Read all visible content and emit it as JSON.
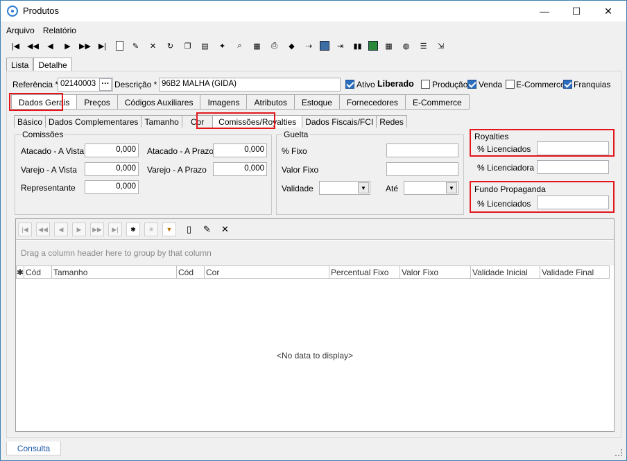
{
  "window": {
    "title": "Produtos",
    "min": "—",
    "max": "☐",
    "close": "✕"
  },
  "menu": {
    "file": "Arquivo",
    "report": "Relatório"
  },
  "main_tabs": [
    "Lista",
    "Detalhe"
  ],
  "header": {
    "ref_label": "Referência *",
    "ref_value": "02140003",
    "ref_btn": "···",
    "desc_label": "Descrição *",
    "desc_value": "96B2 MALHA (GIDA)",
    "ativo_label": "Ativo",
    "status_text": "Liberado",
    "producao_label": "Produção",
    "venda_label": "Venda",
    "ecommerce_label": "E-Commerce",
    "franquias_label": "Franquias"
  },
  "section_tabs": [
    "Dados Gerais",
    "Preços",
    "Códigos Auxiliares",
    "Imagens",
    "Atributos",
    "Estoque",
    "Fornecedores",
    "E-Commerce"
  ],
  "sub_tabs": [
    "Básico",
    "Dados Complementares",
    "Tamanho",
    "Cor",
    "Comissões/Royalties",
    "Dados Fiscais/FCI",
    "Redes"
  ],
  "comissoes": {
    "title": "Comissões",
    "atacado_vista_label": "Atacado - A Vista",
    "atacado_vista_value": "0,000",
    "atacado_prazo_label": "Atacado - A Prazo",
    "atacado_prazo_value": "0,000",
    "varejo_vista_label": "Varejo - A Vista",
    "varejo_vista_value": "0,000",
    "varejo_prazo_label": "Varejo - A Prazo",
    "varejo_prazo_value": "0,000",
    "representante_label": "Representante",
    "representante_value": "0,000"
  },
  "guelta": {
    "title": "Guelta",
    "fixo_label": "% Fixo",
    "valor_fixo_label": "Valor Fixo",
    "validade_label": "Validade",
    "ate_label": "Até"
  },
  "royalties": {
    "title": "Royalties",
    "licenciados_label": "% Licenciados",
    "licenciadora_label": "% Licenciadora"
  },
  "fundo": {
    "title": "Fundo Propaganda",
    "licenciados_label": "% Licenciados"
  },
  "grid": {
    "group_hint": "Drag a column header here to group by that column",
    "columns": [
      "✱",
      "Cód",
      "Tamanho",
      "Cód",
      "Cor",
      "Percentual Fixo",
      "Valor Fixo",
      "Validade Inicial",
      "Validade Final"
    ],
    "empty_text": "<No data to display>"
  },
  "statusbar": {
    "tab": "Consulta"
  }
}
